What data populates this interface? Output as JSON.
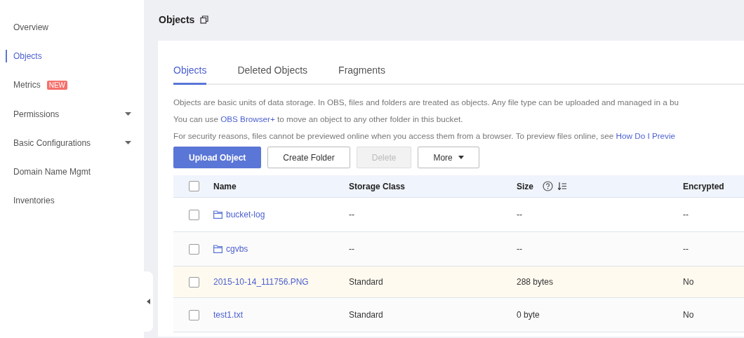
{
  "sidebar": {
    "items": [
      {
        "label": "Overview",
        "selected": false
      },
      {
        "label": "Objects",
        "selected": true
      },
      {
        "label": "Metrics",
        "selected": false,
        "badge": "NEW"
      },
      {
        "label": "Permissions",
        "selected": false,
        "expandable": true
      },
      {
        "label": "Basic Configurations",
        "selected": false,
        "expandable": true
      },
      {
        "label": "Domain Name Mgmt",
        "selected": false
      },
      {
        "label": "Inventories",
        "selected": false
      }
    ]
  },
  "page_title": "Objects",
  "tabs": [
    {
      "label": "Objects",
      "selected": true
    },
    {
      "label": "Deleted Objects",
      "selected": false
    },
    {
      "label": "Fragments",
      "selected": false
    }
  ],
  "info_lines": [
    {
      "parts": [
        {
          "text": "Objects are basic units of data storage. In OBS, files and folders are treated as objects. Any file type can be uploaded and managed in a bu"
        }
      ]
    },
    {
      "parts": [
        {
          "text": "You can use "
        },
        {
          "text": "OBS Browser+",
          "link": true
        },
        {
          "text": " to move an object to any other folder in this bucket."
        }
      ]
    },
    {
      "parts": [
        {
          "text": "For security reasons, files cannot be previewed online when you access them from a browser. To preview files online, see "
        },
        {
          "text": "How Do I Previe",
          "link": true
        }
      ]
    }
  ],
  "buttons": [
    {
      "label": "Upload Object",
      "kind": "primary",
      "disabled": false
    },
    {
      "label": "Create Folder",
      "kind": "default",
      "disabled": false
    },
    {
      "label": "Delete",
      "kind": "default",
      "disabled": true
    },
    {
      "label": "More",
      "kind": "dropdown",
      "disabled": false
    }
  ],
  "table": {
    "select_all_checked": false,
    "columns": [
      "Name",
      "Storage Class",
      "Size",
      "Encrypted"
    ],
    "rows": [
      {
        "name": "bucket-log",
        "kind": "folder",
        "storage_class": "--",
        "size": "--",
        "encrypted": "--",
        "checked": false,
        "highlighted": false
      },
      {
        "name": "cgvbs",
        "kind": "folder",
        "storage_class": "--",
        "size": "--",
        "encrypted": "--",
        "checked": false,
        "highlighted": false
      },
      {
        "name": "2015-10-14_111756.PNG",
        "kind": "file",
        "storage_class": "Standard",
        "size": "288 bytes",
        "encrypted": "No",
        "checked": false,
        "highlighted": true
      },
      {
        "name": "test1.txt",
        "kind": "file",
        "storage_class": "Standard",
        "size": "0 byte",
        "encrypted": "No",
        "checked": false,
        "highlighted": false
      }
    ]
  }
}
